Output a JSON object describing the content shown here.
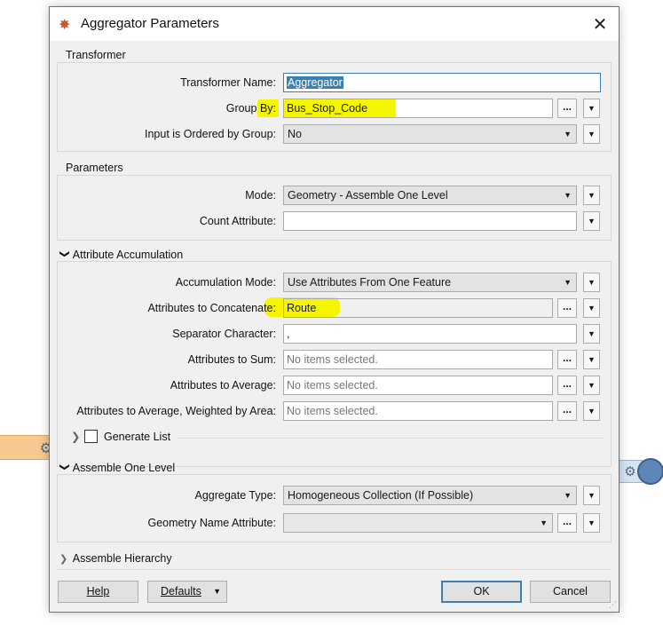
{
  "dialog": {
    "title": "Aggregator Parameters",
    "close_glyph": "✕",
    "app_icon": "fme-transformer-icon"
  },
  "transformer": {
    "section_title": "Transformer",
    "name_label": "Transformer Name:",
    "name_value": "Aggregator",
    "groupby_label_pre": "Group ",
    "groupby_label_post": "By:",
    "groupby_value": "Bus_Stop_Code",
    "ordered_label": "Input is Ordered by Group:",
    "ordered_value": "No"
  },
  "parameters": {
    "section_title": "Parameters",
    "mode_label": "Mode:",
    "mode_value": "Geometry - Assemble One Level",
    "count_label": "Count Attribute:",
    "count_value": ""
  },
  "accumulation": {
    "section_title": "Attribute Accumulation",
    "mode_label": "Accumulation Mode:",
    "mode_value": "Use Attributes From One Feature",
    "concat_label_pre": "Attributes to Concatenate",
    "concat_label_post": ":",
    "concat_value": "Route",
    "separator_label": "Separator Character:",
    "separator_value": ",",
    "sum_label": "Attributes to Sum:",
    "sum_value": "No items selected.",
    "avg_label": "Attributes to Average:",
    "avg_value": "No items selected.",
    "wavg_label": "Attributes to Average, Weighted by Area:",
    "wavg_value": "No items selected.",
    "generate_list_label": "Generate List",
    "generate_list_checked": false
  },
  "assemble": {
    "section_title": "Assemble One Level",
    "type_label": "Aggregate Type:",
    "type_value": "Homogeneous Collection (If Possible)",
    "geomname_label": "Geometry Name Attribute:",
    "geomname_value": ""
  },
  "hierarchy": {
    "section_title": "Assemble Hierarchy"
  },
  "footer": {
    "help_label": "Help",
    "defaults_label": "Defaults",
    "ok_label": "OK",
    "cancel_label": "Cancel"
  },
  "glyphs": {
    "ellipsis": "...",
    "down": "▼",
    "chev_down": "❯",
    "chev_right": "❯"
  },
  "colors": {
    "highlight": "#f5f500",
    "accent": "#3c7fb1",
    "bg_node": "#f5c98f"
  }
}
